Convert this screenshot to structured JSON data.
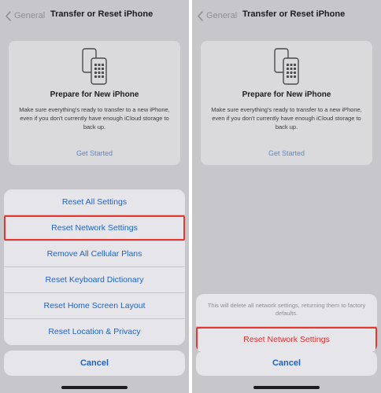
{
  "left_screen": {
    "nav": {
      "back_label": "General",
      "title": "Transfer or Reset iPhone"
    },
    "card": {
      "heading": "Prepare for New iPhone",
      "description": "Make sure everything's ready to transfer to a new iPhone, even if you don't currently have enough iCloud storage to back up.",
      "link": "Get Started"
    },
    "sheet": {
      "items": [
        {
          "label": "Reset All Settings"
        },
        {
          "label": "Reset Network Settings",
          "highlighted": true
        },
        {
          "label": "Remove All Cellular Plans"
        },
        {
          "label": "Reset Keyboard Dictionary"
        },
        {
          "label": "Reset Home Screen Layout"
        },
        {
          "label": "Reset Location & Privacy"
        }
      ],
      "cancel_label": "Cancel"
    }
  },
  "right_screen": {
    "nav": {
      "back_label": "General",
      "title": "Transfer or Reset iPhone"
    },
    "card": {
      "heading": "Prepare for New iPhone",
      "description": "Make sure everything's ready to transfer to a new iPhone, even if you don't currently have enough iCloud storage to back up.",
      "link": "Get Started"
    },
    "alert": {
      "message": "This will delete all network settings, returning them to factory defaults.",
      "confirm_label": "Reset Network Settings",
      "cancel_label": "Cancel"
    }
  },
  "colors": {
    "accent": "#1e63c4",
    "destructive": "#e0302b",
    "highlight_border": "#e6362e"
  }
}
